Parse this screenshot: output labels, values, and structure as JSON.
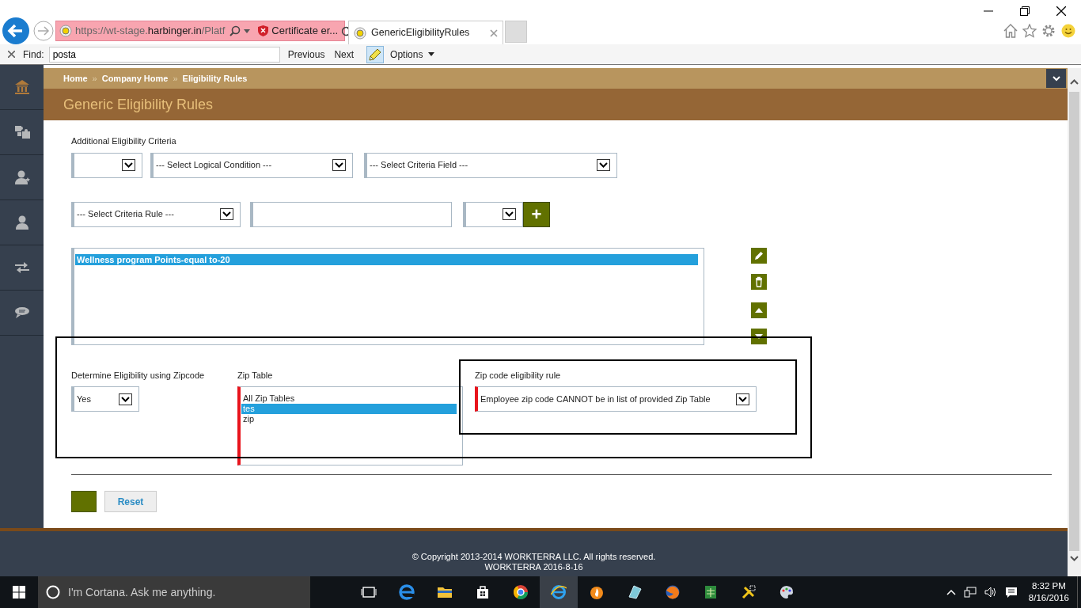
{
  "browser": {
    "address": {
      "url_prefix": "https://wt-stage.",
      "url_host": "harbinger.in",
      "url_suffix": "/Platf",
      "certificate": "Certificate er..."
    },
    "tabs": [
      {
        "label": "GenericEligibilityRules",
        "selected": true
      }
    ],
    "find_bar": {
      "label": "Find:",
      "value": "posta",
      "previous": "Previous",
      "next": "Next",
      "options": "Options"
    }
  },
  "breadcrumb": {
    "separator": "»",
    "items": [
      "Home",
      "Company Home",
      "Eligibility Rules"
    ]
  },
  "page_title": "Generic Eligibility Rules",
  "sidebar": {
    "items": [
      {
        "kind": "home",
        "selected": true
      },
      {
        "kind": "puzzle",
        "selected": false
      },
      {
        "kind": "person-star",
        "selected": false
      },
      {
        "kind": "person",
        "selected": false
      },
      {
        "kind": "arrows",
        "selected": false
      },
      {
        "kind": "chat",
        "selected": false
      }
    ]
  },
  "criteria": {
    "label": "Additional Eligibility Criteria",
    "row_1": [
      {
        "kind": "blank"
      },
      {
        "kind": "select",
        "value": "--- Select Logical Condition ---"
      },
      {
        "kind": "select",
        "value": "--- Select Criteria Field ---"
      }
    ],
    "row_2": {
      "rule": "--- Select Criteria Rule ---",
      "add_button": "+"
    },
    "list": [
      {
        "label": "Wellness program Points-equal to-20",
        "selected": true
      }
    ]
  },
  "zipcode": {
    "determine": {
      "label": "Determine Eligibility using Zipcode",
      "value": "Yes",
      "required": false
    },
    "zip_table": {
      "label": "Zip Table",
      "required": true,
      "options": [
        {
          "label": "All Zip Tables",
          "selected": false
        },
        {
          "label": "tes",
          "selected": true
        },
        {
          "label": "zip",
          "selected": false
        }
      ]
    },
    "rule": {
      "label": "Zip code eligibility rule",
      "value": "Employee zip code CANNOT be in list of provided Zip Table",
      "required": true
    }
  },
  "actions": {
    "reset": "Reset"
  },
  "footer": [
    "© Copyright 2013-2014 WORKTERRA LLC. All rights reserved.",
    "WORKTERRA 2016-8-16"
  ],
  "taskbar": {
    "search_placeholder": "I'm Cortana. Ask me anything.",
    "time": "8:32 PM",
    "date": "8/16/2016"
  }
}
